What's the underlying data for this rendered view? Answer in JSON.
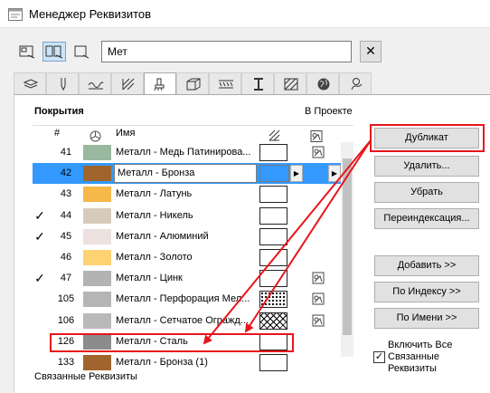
{
  "window": {
    "title": "Менеджер Реквизитов"
  },
  "search": {
    "value": "Мет"
  },
  "tabs": [
    {
      "icon": "layers-icon"
    },
    {
      "icon": "pen-icon"
    },
    {
      "icon": "line-type-icon"
    },
    {
      "icon": "fill-icon"
    },
    {
      "icon": "surface-icon"
    },
    {
      "icon": "building-material-icon"
    },
    {
      "icon": "composite-icon"
    },
    {
      "icon": "profile-icon"
    },
    {
      "icon": "zone-icon"
    },
    {
      "icon": "globe-icon"
    },
    {
      "icon": "markup-icon"
    }
  ],
  "table": {
    "section_title": "Покрытия",
    "in_project_label": "В Проекте",
    "columns": {
      "num": "#",
      "name": "Имя"
    },
    "rows": [
      {
        "check": "",
        "num": "41",
        "name": "Металл - Медь Патинирова...",
        "color": "#9ab8a0",
        "fill": "plain",
        "in_project": true
      },
      {
        "check": "",
        "num": "42",
        "name": "Металл - Бронза",
        "color": "#a0652d",
        "fill": "selected",
        "in_project": false
      },
      {
        "check": "",
        "num": "43",
        "name": "Металл - Латунь",
        "color": "#f5b94a",
        "fill": "plain",
        "in_project": false
      },
      {
        "check": "✓",
        "num": "44",
        "name": "Металл - Никель",
        "color": "#d6cbbb",
        "fill": "plain",
        "in_project": false
      },
      {
        "check": "✓",
        "num": "45",
        "name": "Металл - Алюминий",
        "color": "#ede1e0",
        "fill": "plain",
        "in_project": false
      },
      {
        "check": "",
        "num": "46",
        "name": "Металл - Золото",
        "color": "#fcd273",
        "fill": "plain",
        "in_project": false
      },
      {
        "check": "✓",
        "num": "47",
        "name": "Металл - Цинк",
        "color": "#b3b3b3",
        "fill": "plain",
        "in_project": true
      },
      {
        "check": "",
        "num": "105",
        "name": "Металл - Перфорация Мел...",
        "color": "#b5b5b5",
        "fill": "dots",
        "in_project": true
      },
      {
        "check": "",
        "num": "106",
        "name": "Металл - Сетчатое Огражд...",
        "color": "#b9b9b9",
        "fill": "cross",
        "in_project": true
      },
      {
        "check": "",
        "num": "126",
        "name": "Металл - Сталь",
        "color": "#8c8c8c",
        "fill": "plain",
        "in_project": false
      },
      {
        "check": "",
        "num": "133",
        "name": "Металл - Бронза (1)",
        "color": "#a0652d",
        "fill": "plain",
        "in_project": false
      }
    ]
  },
  "buttons": {
    "duplicate": "Дубликат",
    "delete": "Удалить...",
    "remove": "Убрать",
    "reindex": "Переиндексация...",
    "add": "Добавить >>",
    "by_index": "По Индексу >>",
    "by_name": "По Имени >>"
  },
  "linked_label": "Связанные Реквизиты",
  "include_all": {
    "label": "Включить Все Связанные Реквизиты",
    "checked": true
  },
  "colors": {
    "selection": "#3399ff",
    "highlight": "#e8141c"
  }
}
